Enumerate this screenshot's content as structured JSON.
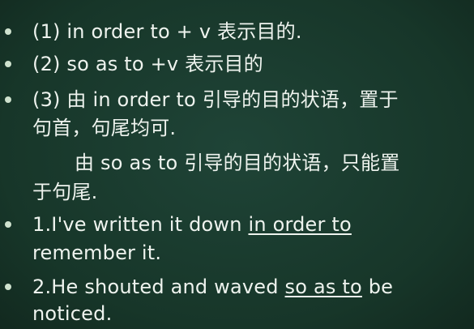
{
  "items": [
    {
      "text": "(1)  in order to + v 表示目的."
    },
    {
      "text": "(2) so as to +v 表示目的"
    },
    {
      "line1": "(3) 由 in order to 引导的目的状语，置于",
      "line2": "句首，句尾均可."
    },
    {
      "line1": "由 so as to 引导的目的状语，只能置",
      "line2": "于句尾."
    },
    {
      "before": "1.I've written it down ",
      "underline": "in order to",
      "line2": "remember it."
    },
    {
      "before": "2.He shouted and waved ",
      "underline": "so as to",
      "after": " be",
      "line2": "noticed."
    }
  ]
}
